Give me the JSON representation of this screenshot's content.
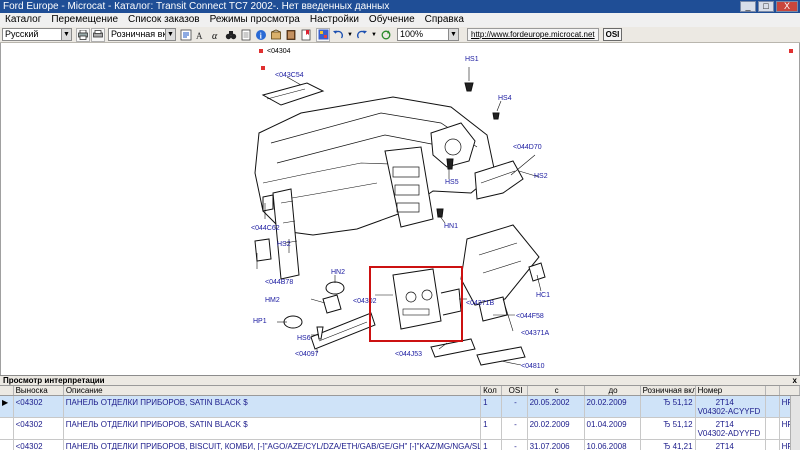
{
  "window": {
    "title": "Ford Europe - Microcat - Каталог: Transit Connect TC7 2002-. Нет введенных данных",
    "minimize": "_",
    "maximize": "□",
    "close": "X"
  },
  "menu": {
    "items": [
      "Каталог",
      "Перемещение",
      "Список заказов",
      "Режимы просмотра",
      "Настройки",
      "Обучение",
      "Справка"
    ]
  },
  "toolbar": {
    "language": "Русский",
    "price_mode": "Розничная вкл.",
    "zoom": "100%",
    "url": "http://www.fordeurope.microcat.net",
    "osi": "OSI",
    "icons": [
      "print-icon",
      "printer-setup-icon",
      "cart-icon",
      "search-text-icon",
      "alpha-icon",
      "binoculars-icon",
      "document-icon",
      "info-icon",
      "box-icon",
      "book-icon",
      "bookmark-icon",
      "palette-icon",
      "undo-icon",
      "redo-icon",
      "refresh-icon"
    ]
  },
  "diagram": {
    "callouts": {
      "c04304": "<04304",
      "c043C54": "<043C54",
      "hs1": "HS1",
      "hs4": "HS4",
      "c044D70": "<044D70",
      "hs2_right": "HS2",
      "hs5": "HS5",
      "hn1": "HN1",
      "c044C62": "<044C62",
      "hs2_left": "HS2",
      "c044B78": "<044B78",
      "hn2": "HN2",
      "hm2": "HM2",
      "c04302": "<04302",
      "c04371B": "<04371B",
      "hc1": "HC1",
      "c044F58": "<044F58",
      "hp1": "HP1",
      "c04371A": "<04371A",
      "hs6": "HS6",
      "c044J53": "<044J53",
      "c04097": "<04097",
      "c04810": "<04810"
    }
  },
  "interpretation": {
    "title": "Просмотр интерпретации",
    "close": "x"
  },
  "grid": {
    "headers": {
      "callout": "Выноска",
      "description": "Описание",
      "qty": "Кол",
      "osi": "OSI",
      "from": "с",
      "to": "до",
      "price": "Розничная вкл",
      "number": "Номер",
      "col_a": "",
      "col_b": ""
    },
    "rows": [
      {
        "marker": "▶",
        "callout": "<04302",
        "description": "ПАНЕЛЬ ОТДЕЛКИ ПРИБОРОВ, SATIN BLACK $",
        "qty": "1",
        "osi": "-",
        "from": "20.05.2002",
        "to": "20.02.2009",
        "price": "Ђ 51,12",
        "number_line1": "2T14",
        "number_line2": "V04302-ACYYFD",
        "col_a": "",
        "col_b": "HP"
      },
      {
        "marker": "",
        "callout": "<04302",
        "description": "ПАНЕЛЬ ОТДЕЛКИ ПРИБОРОВ, SATIN BLACK $",
        "qty": "1",
        "osi": "-",
        "from": "20.02.2009",
        "to": "01.04.2009",
        "price": "Ђ 51,12",
        "number_line1": "2T14",
        "number_line2": "V04302-ADYYFD",
        "col_a": "",
        "col_b": "HP"
      },
      {
        "marker": "",
        "callout": "<04302",
        "description": "ПАНЕЛЬ ОТДЕЛКИ ПРИБОРОВ, BISCUIT, КОМБИ, [-]\"AGO/AZE/CYL/DZA/ETH/GAB/GE/GH\" [-]\"KAZ/MG/NGA/SL/SN/TN/TR\" $",
        "qty": "1",
        "osi": "-",
        "from": "31.07.2006",
        "to": "10.06.2008",
        "price": "Ђ 41,21",
        "number_line1": "2T14",
        "number_line2": "",
        "col_a": "",
        "col_b": "HP"
      }
    ]
  }
}
